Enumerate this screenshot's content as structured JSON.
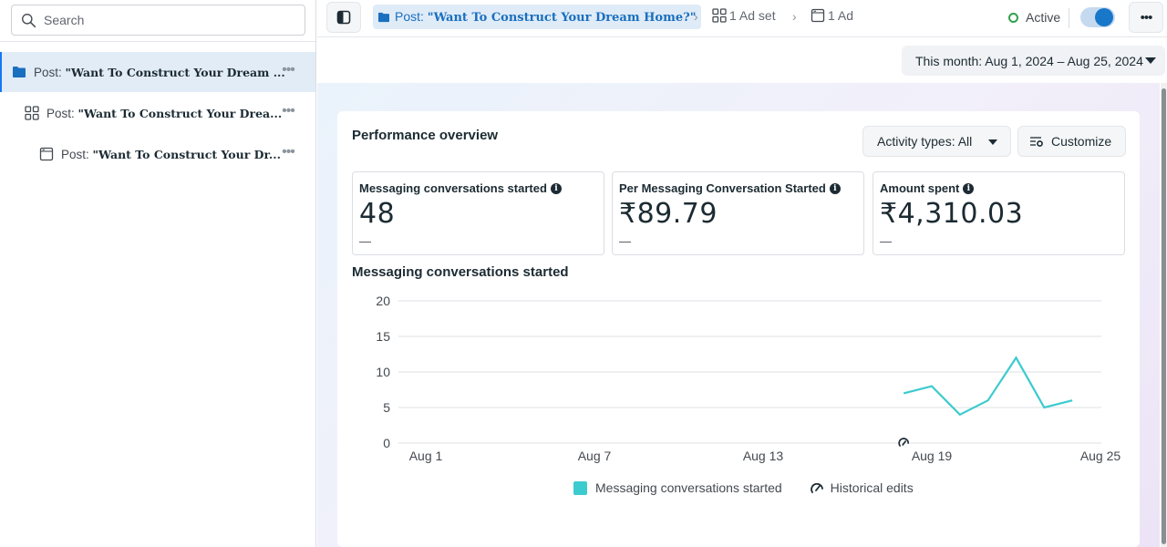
{
  "sidebar": {
    "search_placeholder": "Search",
    "items": [
      {
        "prefix": "Post: ",
        "title": "\"Want To Construct Your Dream ...",
        "level": "campaign",
        "icon": "folder-icon",
        "selected": true
      },
      {
        "prefix": "Post: ",
        "title": "\"Want To Construct Your Drea...",
        "level": "ad-set",
        "icon": "grid-icon",
        "selected": false
      },
      {
        "prefix": "Post: ",
        "title": "\"Want To Construct Your Dr...",
        "level": "ad",
        "icon": "ad-window-icon",
        "selected": false
      }
    ],
    "more_label": "•••"
  },
  "topbar": {
    "campaign_prefix": "Post: ",
    "campaign_title": "\"Want To Construct Your Dream Home?\"",
    "adset_crumb": "1 Ad set",
    "ad_crumb": "1 Ad",
    "chevron": "›",
    "status_label": "Active",
    "toggle_on": true,
    "more_label": "•••"
  },
  "date_range": {
    "label": "This month: Aug 1, 2024 – Aug 25, 2024"
  },
  "performance": {
    "title": "Performance overview",
    "activity_types_label": "Activity types: All",
    "customize_label": "Customize",
    "metrics": [
      {
        "label": "Messaging conversations started",
        "value": "48",
        "delta": "—"
      },
      {
        "label": "Per Messaging Conversation Started",
        "value": "₹89.79",
        "delta": "—"
      },
      {
        "label": "Amount spent",
        "value": "₹4,310.03",
        "delta": "—"
      }
    ],
    "chart_title": "Messaging conversations started"
  },
  "colors": {
    "series": "#3ccbcf",
    "accent": "#1877c9",
    "active": "#31a24c"
  },
  "chart_data": {
    "type": "line",
    "title": "Messaging conversations started",
    "xlabel": "",
    "ylabel": "",
    "x_range": [
      "Aug 1",
      "Aug 25"
    ],
    "x_days_range": [
      1,
      25
    ],
    "x_ticks": [
      {
        "day": 1,
        "label": "Aug 1"
      },
      {
        "day": 7,
        "label": "Aug 7"
      },
      {
        "day": 13,
        "label": "Aug 13"
      },
      {
        "day": 19,
        "label": "Aug 19"
      },
      {
        "day": 25,
        "label": "Aug 25"
      }
    ],
    "y_ticks": [
      0,
      5,
      10,
      15,
      20
    ],
    "ylim": [
      0,
      20
    ],
    "grid": true,
    "series": [
      {
        "name": "Messaging conversations started",
        "x": [
          "Aug 18",
          "Aug 19",
          "Aug 20",
          "Aug 21",
          "Aug 22",
          "Aug 23",
          "Aug 24"
        ],
        "days": [
          18,
          19,
          20,
          21,
          22,
          23,
          24
        ],
        "values": [
          7,
          8,
          4,
          6,
          12,
          5,
          6
        ]
      }
    ],
    "annotations": [
      {
        "type": "historical-edit",
        "day": 18
      }
    ],
    "legend": {
      "position": "bottom",
      "entries": [
        "Messaging conversations started",
        "Historical edits"
      ]
    }
  }
}
